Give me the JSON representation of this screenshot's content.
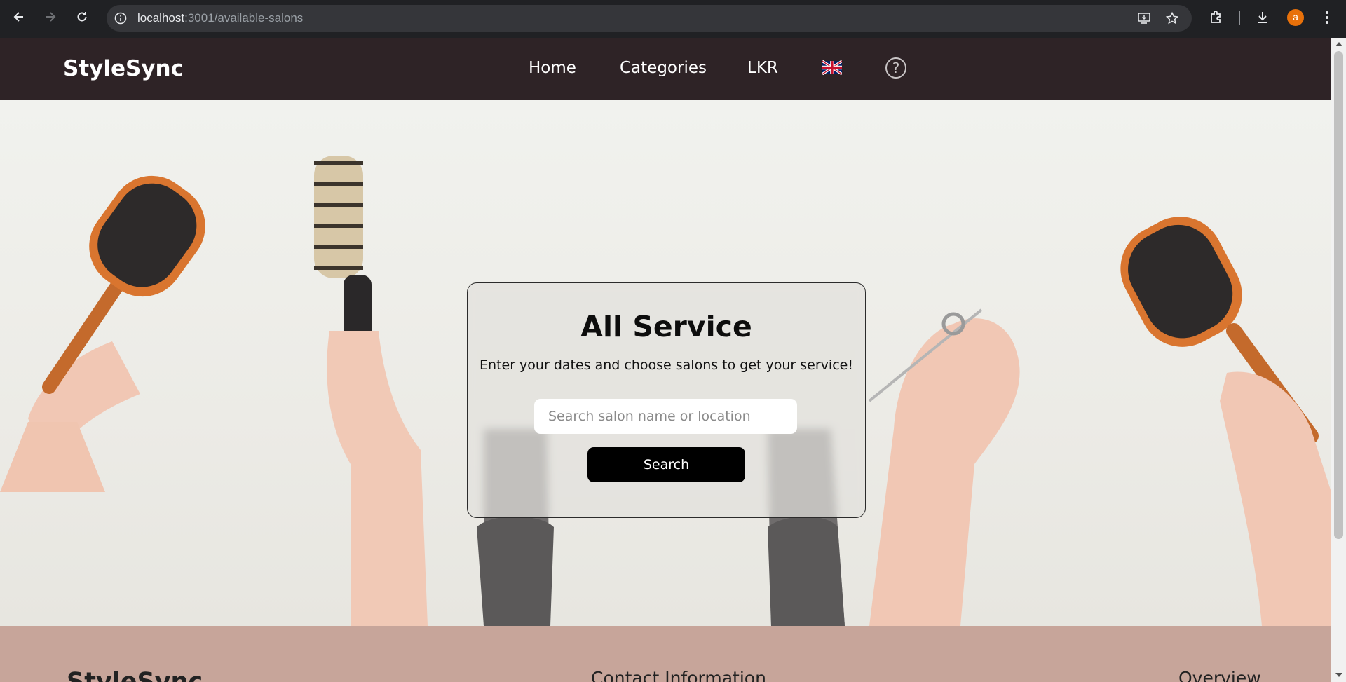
{
  "browser": {
    "url_host": "localhost",
    "url_path": ":3001/available-salons",
    "profile_initial": "a"
  },
  "header": {
    "logo": "StyleSync",
    "nav": [
      "Home",
      "Categories",
      "LKR"
    ],
    "language_icon": "uk-flag-icon",
    "help_label": "?"
  },
  "hero": {
    "title": "All Service",
    "subtitle": "Enter your dates and choose salons to get your service!",
    "search_placeholder": "Search salon name or location",
    "search_button": "Search"
  },
  "footer": {
    "logo": "StyleSync",
    "contact_heading": "Contact Information",
    "overview_heading": "Overview"
  },
  "colors": {
    "header_bg": "#2e2326",
    "footer_bg": "#c7a59a",
    "button_bg": "#000000"
  }
}
